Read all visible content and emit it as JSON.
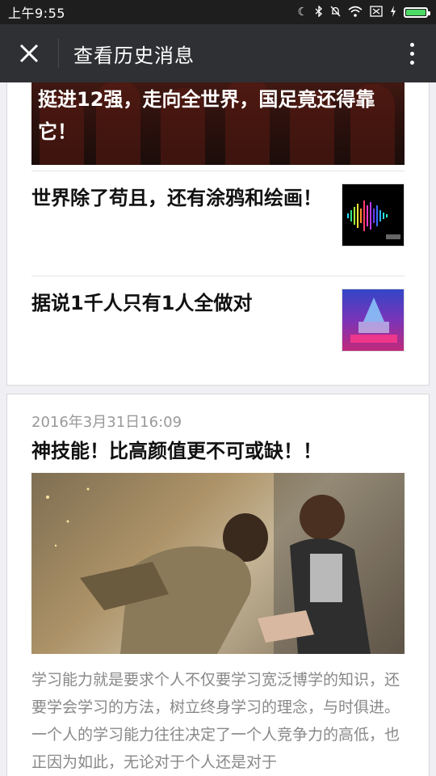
{
  "status_bar": {
    "time": "上午9:55",
    "icons": [
      "moon-icon",
      "bluetooth-icon",
      "bell-off-icon",
      "wifi-icon",
      "sim-icon",
      "charging-icon",
      "battery-icon"
    ],
    "battery_level": 1.0
  },
  "navbar": {
    "title": "查看历史消息",
    "close_icon": "close-icon",
    "more_icon": "more-vertical-icon"
  },
  "group1": {
    "hero_title": "挺进12强，走向全世界，国足竟还得靠它！",
    "items": [
      {
        "title": "世界除了苟且，还有涂鸦和绘画！"
      },
      {
        "title": "据说1千人只有1人全做对"
      }
    ]
  },
  "group2": {
    "date": "2016年3月31日16:09",
    "title": "神技能！比高颜值更不可或缺！！",
    "summary": "学习能力就是要求个人不仅要学习宽泛博学的知识，还要学会学习的方法，树立终身学习的理念，与时俱进。一个人的学习能力往往决定了一个人竞争力的高低，也正因为如此，无论对于个人还是对于"
  },
  "colors": {
    "status_bar_bg": "#1e1e1e",
    "nav_bg": "#2f3033",
    "page_bg": "#efeff4",
    "date_text": "#999999",
    "summary_text": "#888888",
    "battery_fill": "#4cd964"
  }
}
